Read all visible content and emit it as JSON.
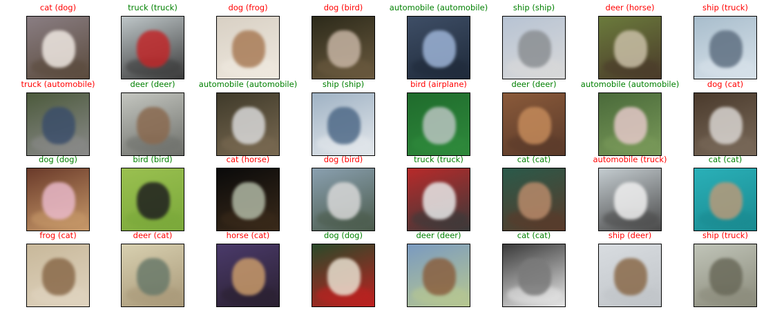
{
  "colors": {
    "correct": "#008000",
    "wrong": "#ff0000"
  },
  "rows": [
    [
      {
        "label": "cat (dog)",
        "correct": false,
        "thumb": [
          "#8a7e83",
          "#efe8e2",
          "#5a4a3c"
        ]
      },
      {
        "label": "truck (truck)",
        "correct": true,
        "thumb": [
          "#bfc7c9",
          "#c0282a",
          "#3a3a3a"
        ]
      },
      {
        "label": "dog (frog)",
        "correct": false,
        "thumb": [
          "#d8d0c4",
          "#a97c57",
          "#efe9df"
        ]
      },
      {
        "label": "dog (bird)",
        "correct": false,
        "thumb": [
          "#2c2a1a",
          "#c6b4a3",
          "#6b5a3f"
        ]
      },
      {
        "label": "automobile (automobile)",
        "correct": true,
        "thumb": [
          "#3e4e66",
          "#9cb3d6",
          "#1f2a3a"
        ]
      },
      {
        "label": "ship (ship)",
        "correct": true,
        "thumb": [
          "#b7c3d3",
          "#8b8f93",
          "#d9d9d9"
        ]
      },
      {
        "label": "deer (horse)",
        "correct": false,
        "thumb": [
          "#6b7b3c",
          "#c9bfa6",
          "#4a3a2a"
        ]
      },
      {
        "label": "ship (truck)",
        "correct": false,
        "thumb": [
          "#a8bdcc",
          "#5f7082",
          "#d8e2ea"
        ]
      }
    ],
    [
      {
        "label": "truck (automobile)",
        "correct": false,
        "thumb": [
          "#4c5a3c",
          "#3b4e6a",
          "#8b8b8b"
        ]
      },
      {
        "label": "deer (deer)",
        "correct": true,
        "thumb": [
          "#c4c6c0",
          "#8a6a50",
          "#6d6f6a"
        ]
      },
      {
        "label": "automobile (automobile)",
        "correct": true,
        "thumb": [
          "#3f3a2a",
          "#d8d8d8",
          "#7a6a52"
        ]
      },
      {
        "label": "ship (ship)",
        "correct": true,
        "thumb": [
          "#9fb2c4",
          "#4f6a88",
          "#e4e8ec"
        ]
      },
      {
        "label": "bird (airplane)",
        "correct": false,
        "thumb": [
          "#1f6b2c",
          "#b9c4c0",
          "#2f8a3c"
        ]
      },
      {
        "label": "deer (deer)",
        "correct": true,
        "thumb": [
          "#8a5a3a",
          "#c48a5a",
          "#5a3a2a"
        ]
      },
      {
        "label": "automobile (automobile)",
        "correct": true,
        "thumb": [
          "#4a6a3a",
          "#e4c8c8",
          "#7a9a5a"
        ]
      },
      {
        "label": "dog (cat)",
        "correct": false,
        "thumb": [
          "#4a3a2c",
          "#d8d4d0",
          "#7a6a5a"
        ]
      }
    ],
    [
      {
        "label": "dog (dog)",
        "correct": true,
        "thumb": [
          "#6a3a2a",
          "#e8b8c8",
          "#c89a6a"
        ]
      },
      {
        "label": "bird (bird)",
        "correct": true,
        "thumb": [
          "#9ac050",
          "#1f1f1f",
          "#7aa83a"
        ]
      },
      {
        "label": "cat (horse)",
        "correct": false,
        "thumb": [
          "#0a0a0a",
          "#b0b8a4",
          "#3a2a1a"
        ]
      },
      {
        "label": "dog (bird)",
        "correct": false,
        "thumb": [
          "#8aa0b0",
          "#d8d8d8",
          "#4a5a4a"
        ]
      },
      {
        "label": "truck (truck)",
        "correct": true,
        "thumb": [
          "#b82a2a",
          "#e8e8e8",
          "#3a3a3a"
        ]
      },
      {
        "label": "cat (cat)",
        "correct": true,
        "thumb": [
          "#2a5a4a",
          "#b88a6a",
          "#5a3a2a"
        ]
      },
      {
        "label": "automobile (truck)",
        "correct": false,
        "thumb": [
          "#c4ccd0",
          "#f0f0f0",
          "#4a4a4a"
        ]
      },
      {
        "label": "cat (cat)",
        "correct": true,
        "thumb": [
          "#2ab0b8",
          "#b89a7a",
          "#1a8a90"
        ]
      }
    ],
    [
      {
        "label": "frog (cat)",
        "correct": false,
        "thumb": [
          "#c8b89a",
          "#8a6a4a",
          "#e0d4c0"
        ]
      },
      {
        "label": "deer (cat)",
        "correct": false,
        "thumb": [
          "#d8d0b0",
          "#6a7a6a",
          "#a89878"
        ]
      },
      {
        "label": "horse (cat)",
        "correct": false,
        "thumb": [
          "#4a3a6a",
          "#c89a6a",
          "#2a2030"
        ]
      },
      {
        "label": "dog (dog)",
        "correct": true,
        "thumb": [
          "#2a4a2a",
          "#e8e0d0",
          "#c02020"
        ]
      },
      {
        "label": "deer (deer)",
        "correct": true,
        "thumb": [
          "#7a9ac0",
          "#8a6040",
          "#b8c890"
        ]
      },
      {
        "label": "cat (cat)",
        "correct": true,
        "thumb": [
          "#3a3a3a",
          "#7a7a7a",
          "#e8e8e8"
        ]
      },
      {
        "label": "ship (deer)",
        "correct": false,
        "thumb": [
          "#d8dce0",
          "#8a6a4a",
          "#c0c4c8"
        ]
      },
      {
        "label": "ship (truck)",
        "correct": false,
        "thumb": [
          "#c0c4b8",
          "#6a6a5a",
          "#8a8a7a"
        ]
      }
    ]
  ]
}
